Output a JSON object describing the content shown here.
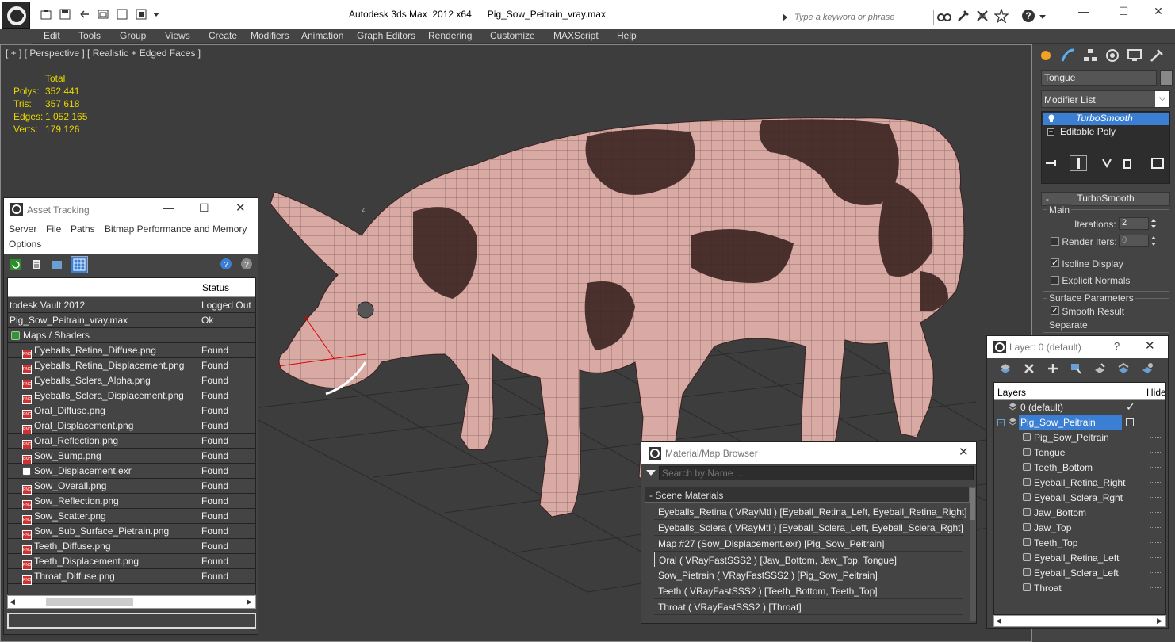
{
  "window": {
    "title": "Autodesk 3ds Max  2012 x64      Pig_Sow_Peitrain_vray.max",
    "search_placeholder": "Type a keyword or phrase",
    "controls": {
      "minimize": "—",
      "maximize": "☐",
      "close": "✕"
    }
  },
  "menu": [
    "Edit",
    "Tools",
    "Group",
    "Views",
    "Create",
    "Modifiers",
    "Animation",
    "Graph Editors",
    "Rendering",
    "Customize",
    "MAXScript",
    "Help"
  ],
  "viewport": {
    "label": "[ + ] [ Perspective ] [ Realistic + Edged Faces ]",
    "stats": {
      "header": "Total",
      "rows": [
        {
          "label": "Polys:",
          "value": "352 441"
        },
        {
          "label": "Tris:",
          "value": "357 618"
        },
        {
          "label": "Edges:",
          "value": "1 052 165"
        },
        {
          "label": "Verts:",
          "value": "179 126"
        }
      ]
    }
  },
  "command_panel": {
    "object_name": "Tongue",
    "modifier_list": "Modifier List",
    "stack": [
      "TurboSmooth",
      "Editable Poly"
    ],
    "rollout_title": "TurboSmooth",
    "main_group": "Main",
    "iterations_label": "Iterations:",
    "iterations_value": "2",
    "render_iters_label": "Render Iters:",
    "render_iters_value": "0",
    "isoline_label": "Isoline Display",
    "explicit_label": "Explicit Normals",
    "surface_group": "Surface Parameters",
    "smooth_label": "Smooth Result",
    "separate_label": "Separate"
  },
  "asset_tracking": {
    "title": "Asset Tracking",
    "menu": [
      "Server",
      "File",
      "Paths",
      "Bitmap Performance and Memory",
      "Options"
    ],
    "status_header": "Status",
    "rows": [
      {
        "name": "todesk Vault 2012",
        "status": "Logged Out ..",
        "kind": "none"
      },
      {
        "name": "Pig_Sow_Peitrain_vray.max",
        "status": "Ok",
        "kind": "none"
      },
      {
        "name": "Maps / Shaders",
        "status": "",
        "kind": "folder"
      },
      {
        "name": "Eyeballs_Retina_Diffuse.png",
        "status": "Found",
        "kind": "png"
      },
      {
        "name": "Eyeballs_Retina_Displacement.png",
        "status": "Found",
        "kind": "png"
      },
      {
        "name": "Eyeballs_Sclera_Alpha.png",
        "status": "Found",
        "kind": "png"
      },
      {
        "name": "Eyeballs_Sclera_Displacement.png",
        "status": "Found",
        "kind": "png"
      },
      {
        "name": "Oral_Diffuse.png",
        "status": "Found",
        "kind": "png"
      },
      {
        "name": "Oral_Displacement.png",
        "status": "Found",
        "kind": "png"
      },
      {
        "name": "Oral_Reflection.png",
        "status": "Found",
        "kind": "png"
      },
      {
        "name": "Sow_Bump.png",
        "status": "Found",
        "kind": "png"
      },
      {
        "name": "Sow_Displacement.exr",
        "status": "Found",
        "kind": "exr"
      },
      {
        "name": "Sow_Overall.png",
        "status": "Found",
        "kind": "png"
      },
      {
        "name": "Sow_Reflection.png",
        "status": "Found",
        "kind": "png"
      },
      {
        "name": "Sow_Scatter.png",
        "status": "Found",
        "kind": "png"
      },
      {
        "name": "Sow_Sub_Surface_Pietrain.png",
        "status": "Found",
        "kind": "png"
      },
      {
        "name": "Teeth_Diffuse.png",
        "status": "Found",
        "kind": "png"
      },
      {
        "name": "Teeth_Displacement.png",
        "status": "Found",
        "kind": "png"
      },
      {
        "name": "Throat_Diffuse.png",
        "status": "Found",
        "kind": "png"
      }
    ]
  },
  "material_browser": {
    "title": "Material/Map Browser",
    "search_placeholder": "Search by Name ...",
    "group": "- Scene Materials",
    "items": [
      "Eyeballs_Retina  ( VRayMtl )  [Eyeball_Retina_Left, Eyeball_Retina_Right]",
      "Eyeballs_Sclera  ( VRayMtl )  [Eyeball_Sclera_Left, Eyeball_Sclera_Rght]",
      "Map #27 (Sow_Displacement.exr)  [Pig_Sow_Peitrain]",
      "Oral  ( VRayFastSSS2 )  [Jaw_Bottom, Jaw_Top, Tongue]",
      "Sow_Pietrain  ( VRayFastSSS2 )  [Pig_Sow_Peitrain]",
      "Teeth  ( VRayFastSSS2 )  [Teeth_Bottom, Teeth_Top]",
      "Throat  ( VRayFastSSS2 )  [Throat]"
    ]
  },
  "layer_manager": {
    "title": "Layer: 0 (default)",
    "help": "?",
    "col_layers": "Layers",
    "col_hide": "Hide",
    "default_layer": "0 (default)",
    "group_layer": "Pig_Sow_Peitrain",
    "objects": [
      "Pig_Sow_Peitrain",
      "Tongue",
      "Teeth_Bottom",
      "Eyeball_Retina_Right",
      "Eyeball_Sclera_Rght",
      "Jaw_Bottom",
      "Jaw_Top",
      "Teeth_Top",
      "Eyeball_Retina_Left",
      "Eyeball_Sclera_Left",
      "Throat"
    ]
  }
}
